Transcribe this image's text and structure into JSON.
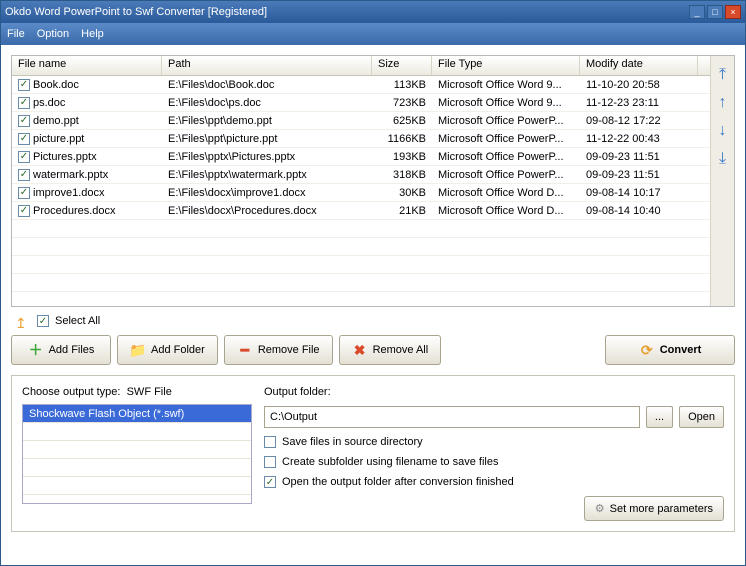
{
  "window": {
    "title": "Okdo Word PowerPoint to Swf Converter [Registered]"
  },
  "menu": {
    "file": "File",
    "option": "Option",
    "help": "Help"
  },
  "table": {
    "headers": {
      "name": "File name",
      "path": "Path",
      "size": "Size",
      "type": "File Type",
      "date": "Modify date"
    },
    "rows": [
      {
        "name": "Book.doc",
        "path": "E:\\Files\\doc\\Book.doc",
        "size": "113KB",
        "type": "Microsoft Office Word 9...",
        "date": "11-10-20 20:58"
      },
      {
        "name": "ps.doc",
        "path": "E:\\Files\\doc\\ps.doc",
        "size": "723KB",
        "type": "Microsoft Office Word 9...",
        "date": "11-12-23 23:11"
      },
      {
        "name": "demo.ppt",
        "path": "E:\\Files\\ppt\\demo.ppt",
        "size": "625KB",
        "type": "Microsoft Office PowerP...",
        "date": "09-08-12 17:22"
      },
      {
        "name": "picture.ppt",
        "path": "E:\\Files\\ppt\\picture.ppt",
        "size": "1166KB",
        "type": "Microsoft Office PowerP...",
        "date": "11-12-22 00:43"
      },
      {
        "name": "Pictures.pptx",
        "path": "E:\\Files\\pptx\\Pictures.pptx",
        "size": "193KB",
        "type": "Microsoft Office PowerP...",
        "date": "09-09-23 11:51"
      },
      {
        "name": "watermark.pptx",
        "path": "E:\\Files\\pptx\\watermark.pptx",
        "size": "318KB",
        "type": "Microsoft Office PowerP...",
        "date": "09-09-23 11:51"
      },
      {
        "name": "improve1.docx",
        "path": "E:\\Files\\docx\\improve1.docx",
        "size": "30KB",
        "type": "Microsoft Office Word D...",
        "date": "09-08-14 10:17"
      },
      {
        "name": "Procedures.docx",
        "path": "E:\\Files\\docx\\Procedures.docx",
        "size": "21KB",
        "type": "Microsoft Office Word D...",
        "date": "09-08-14 10:40"
      }
    ]
  },
  "selectall": "Select All",
  "buttons": {
    "addfiles": "Add Files",
    "addfolder": "Add Folder",
    "removefile": "Remove File",
    "removeall": "Remove All",
    "convert": "Convert"
  },
  "output": {
    "type_label": "Choose output type:",
    "type_value": "SWF File",
    "type_list": "Shockwave Flash Object (*.swf)",
    "folder_label": "Output folder:",
    "folder_value": "C:\\Output",
    "browse": "...",
    "open": "Open",
    "opt1": "Save files in source directory",
    "opt2": "Create subfolder using filename to save files",
    "opt3": "Open the output folder after conversion finished",
    "params": "Set more parameters"
  }
}
